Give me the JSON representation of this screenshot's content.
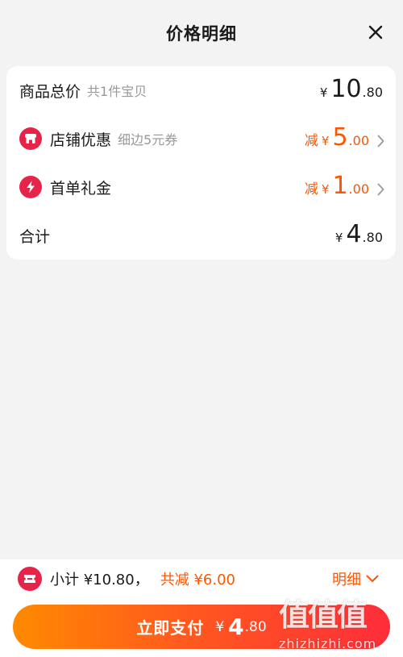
{
  "header": {
    "title": "价格明细"
  },
  "rows": {
    "total": {
      "label": "商品总价",
      "sub": "共1件宝贝",
      "yen": "¥",
      "int": "10",
      "dec": ".80"
    },
    "shop": {
      "label": "店铺优惠",
      "sub": "细边5元券",
      "minus": "减",
      "yen": "¥",
      "int": "5",
      "dec": ".00"
    },
    "first": {
      "label": "首单礼金",
      "minus": "减",
      "yen": "¥",
      "int": "1",
      "dec": ".00"
    },
    "sum": {
      "label": "合计",
      "yen": "¥",
      "int": "4",
      "dec": ".80"
    }
  },
  "footer": {
    "subtotal": "小计 ¥10.80，",
    "saved": "共减 ¥6.00",
    "detail": "明细",
    "pay": {
      "label": "立即支付",
      "yen": "¥",
      "int": "4",
      "dec": ".80"
    }
  },
  "watermark": {
    "chars": "值值值",
    "url": "zhizhizhi.com"
  },
  "colors": {
    "accent": "#ff5500",
    "icon_red": "#e8234a",
    "button_start": "#ff8a00",
    "button_end": "#ff2d3a"
  },
  "icons": [
    "close-icon",
    "shop-icon",
    "lightning-icon",
    "chevron-right-icon",
    "ticket-icon",
    "chevron-down-icon"
  ]
}
